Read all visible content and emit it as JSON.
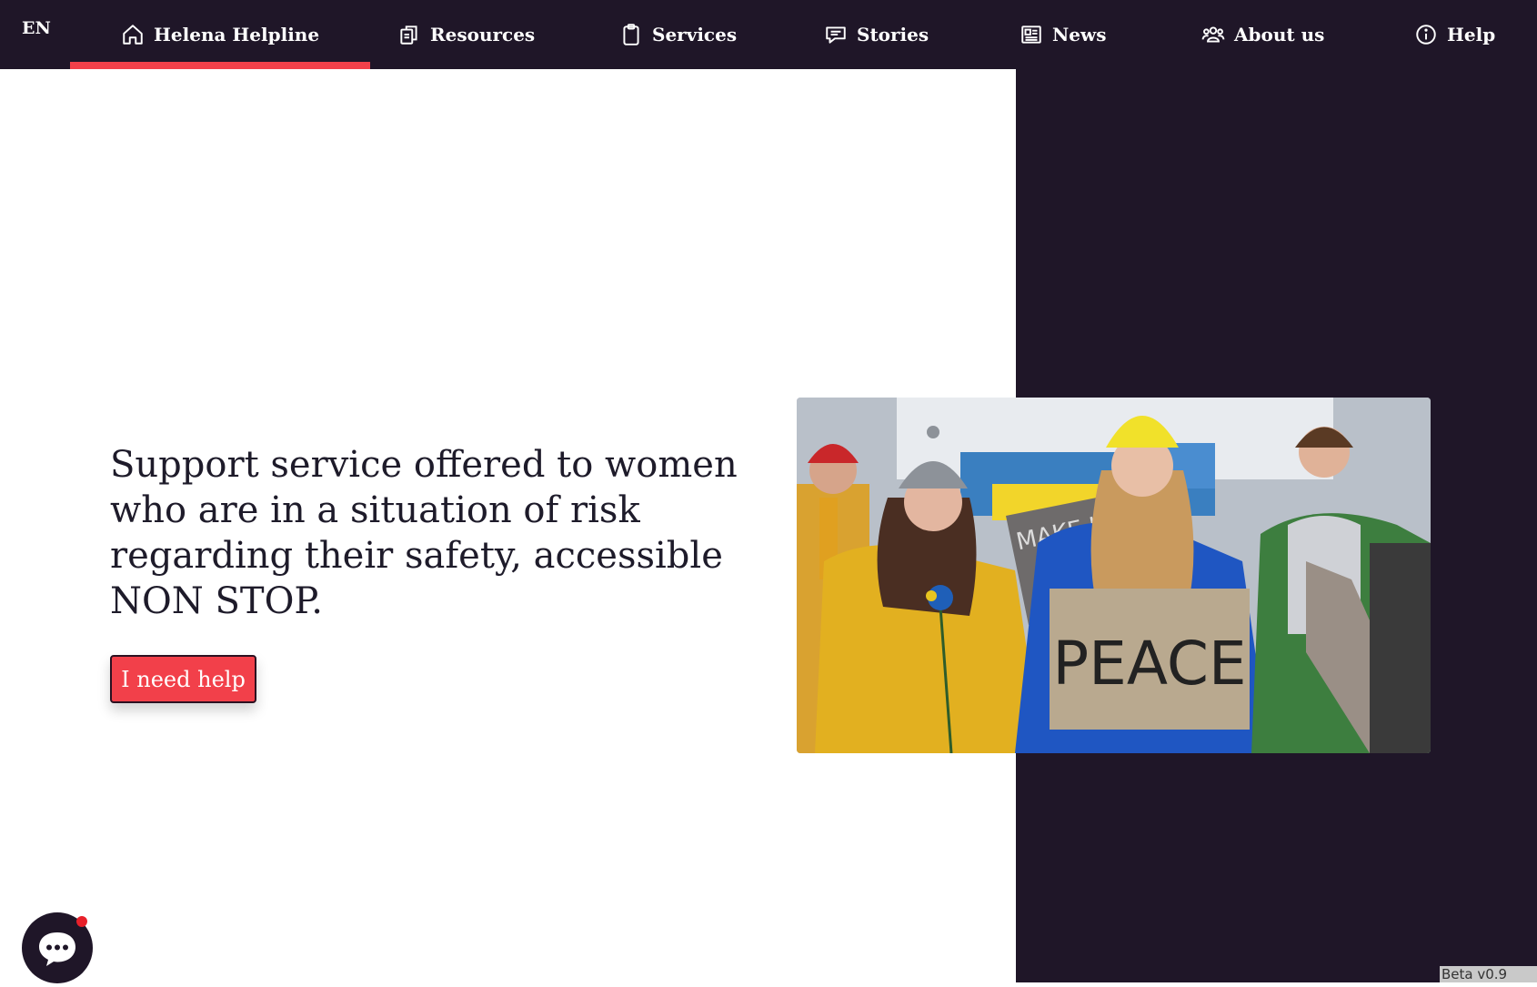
{
  "nav": {
    "language": "EN",
    "items": [
      {
        "label": "Helena Helpline",
        "icon": "home-icon",
        "active": true
      },
      {
        "label": "Resources",
        "icon": "documents-icon"
      },
      {
        "label": "Services",
        "icon": "clipboard-icon"
      },
      {
        "label": "Stories",
        "icon": "chat-bubble-icon"
      },
      {
        "label": "News",
        "icon": "newspaper-icon"
      },
      {
        "label": "About us",
        "icon": "people-icon"
      },
      {
        "label": "Help",
        "icon": "info-icon"
      }
    ]
  },
  "hero": {
    "headline": "Support service offered to women who are in a situation of risk regarding their safety, accessible NON STOP.",
    "cta_label": "I need help",
    "image_sign_text": "PEACE",
    "image_sign2_text": "MAKE LOVE"
  },
  "footer": {
    "chat_icon": "chat-icon",
    "beta_label": "Beta v0.9"
  },
  "colors": {
    "nav_bg": "#1f1628",
    "accent": "#f2404a",
    "text": "#1e1b2a"
  }
}
